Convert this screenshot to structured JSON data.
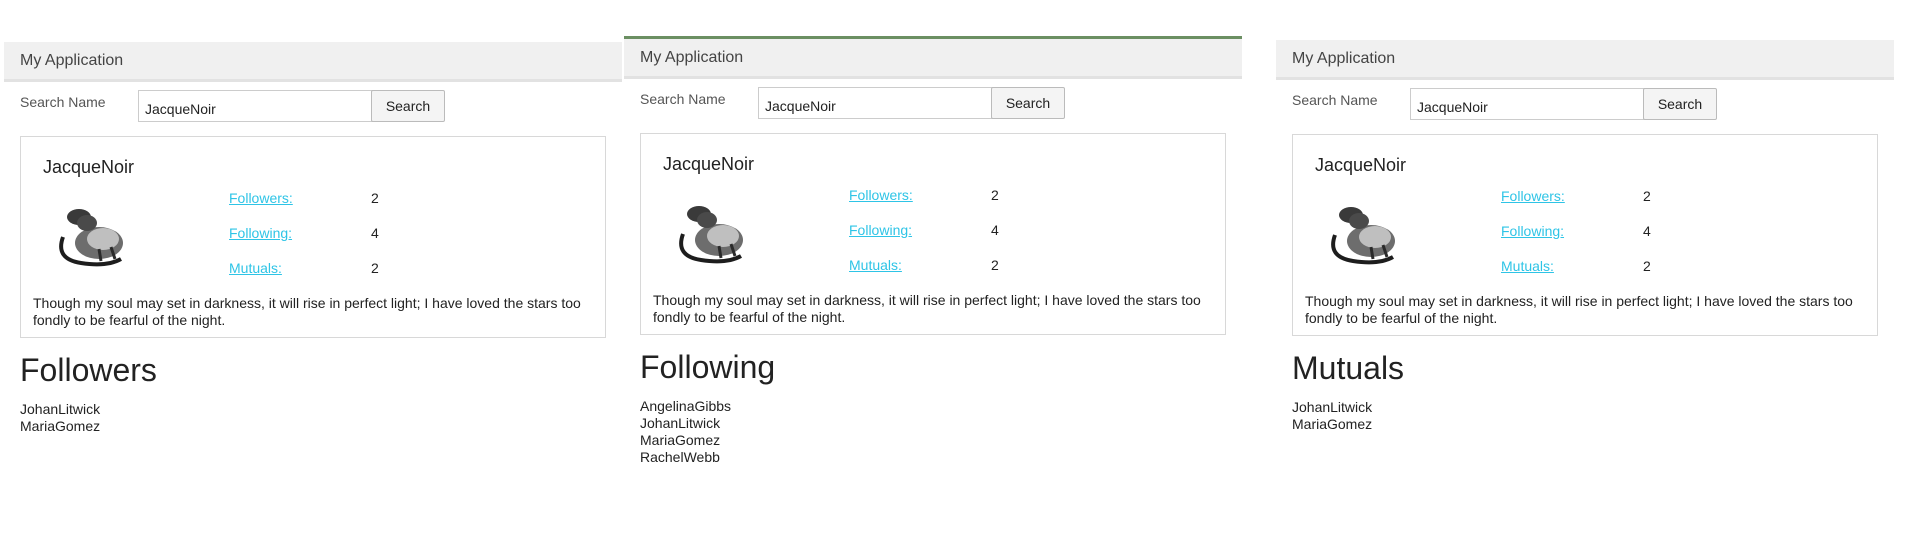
{
  "panels": [
    {
      "app_title": "My Application",
      "search": {
        "label": "Search Name",
        "value": "JacqueNoir",
        "button": "Search"
      },
      "profile": {
        "name": "JacqueNoir",
        "followers_label": "Followers:",
        "followers": "2",
        "following_label": "Following:",
        "following": "4",
        "mutuals_label": "Mutuals:",
        "mutuals": "2",
        "bio": "Though my soul may set in darkness, it will rise in perfect light; I have loved the stars too fondly to be fearful of the night."
      },
      "section_title": "Followers",
      "names": [
        "JohanLitwick",
        "MariaGomez"
      ]
    },
    {
      "app_title": "My Application",
      "search": {
        "label": "Search Name",
        "value": "JacqueNoir",
        "button": "Search"
      },
      "profile": {
        "name": "JacqueNoir",
        "followers_label": "Followers:",
        "followers": "2",
        "following_label": "Following:",
        "following": "4",
        "mutuals_label": "Mutuals:",
        "mutuals": "2",
        "bio": "Though my soul may set in darkness, it will rise in perfect light; I have loved the stars too fondly to be fearful of the night."
      },
      "section_title": "Following",
      "names": [
        "AngelinaGibbs",
        "JohanLitwick",
        "MariaGomez",
        "RachelWebb"
      ]
    },
    {
      "app_title": "My Application",
      "search": {
        "label": "Search Name",
        "value": "JacqueNoir",
        "button": "Search"
      },
      "profile": {
        "name": "JacqueNoir",
        "followers_label": "Followers:",
        "followers": "2",
        "following_label": "Following:",
        "following": "4",
        "mutuals_label": "Mutuals:",
        "mutuals": "2",
        "bio": "Though my soul may set in darkness, it will rise in perfect light; I have loved the stars too fondly to be fearful of the night."
      },
      "section_title": "Mutuals",
      "names": [
        "JohanLitwick",
        "MariaGomez"
      ]
    }
  ],
  "colors": {
    "link": "#2ec4e6",
    "appbar_bg": "#f0f0f0",
    "active_accent": "#6b8f62"
  },
  "icons": {
    "avatar": "black-cat-avatar-icon"
  }
}
